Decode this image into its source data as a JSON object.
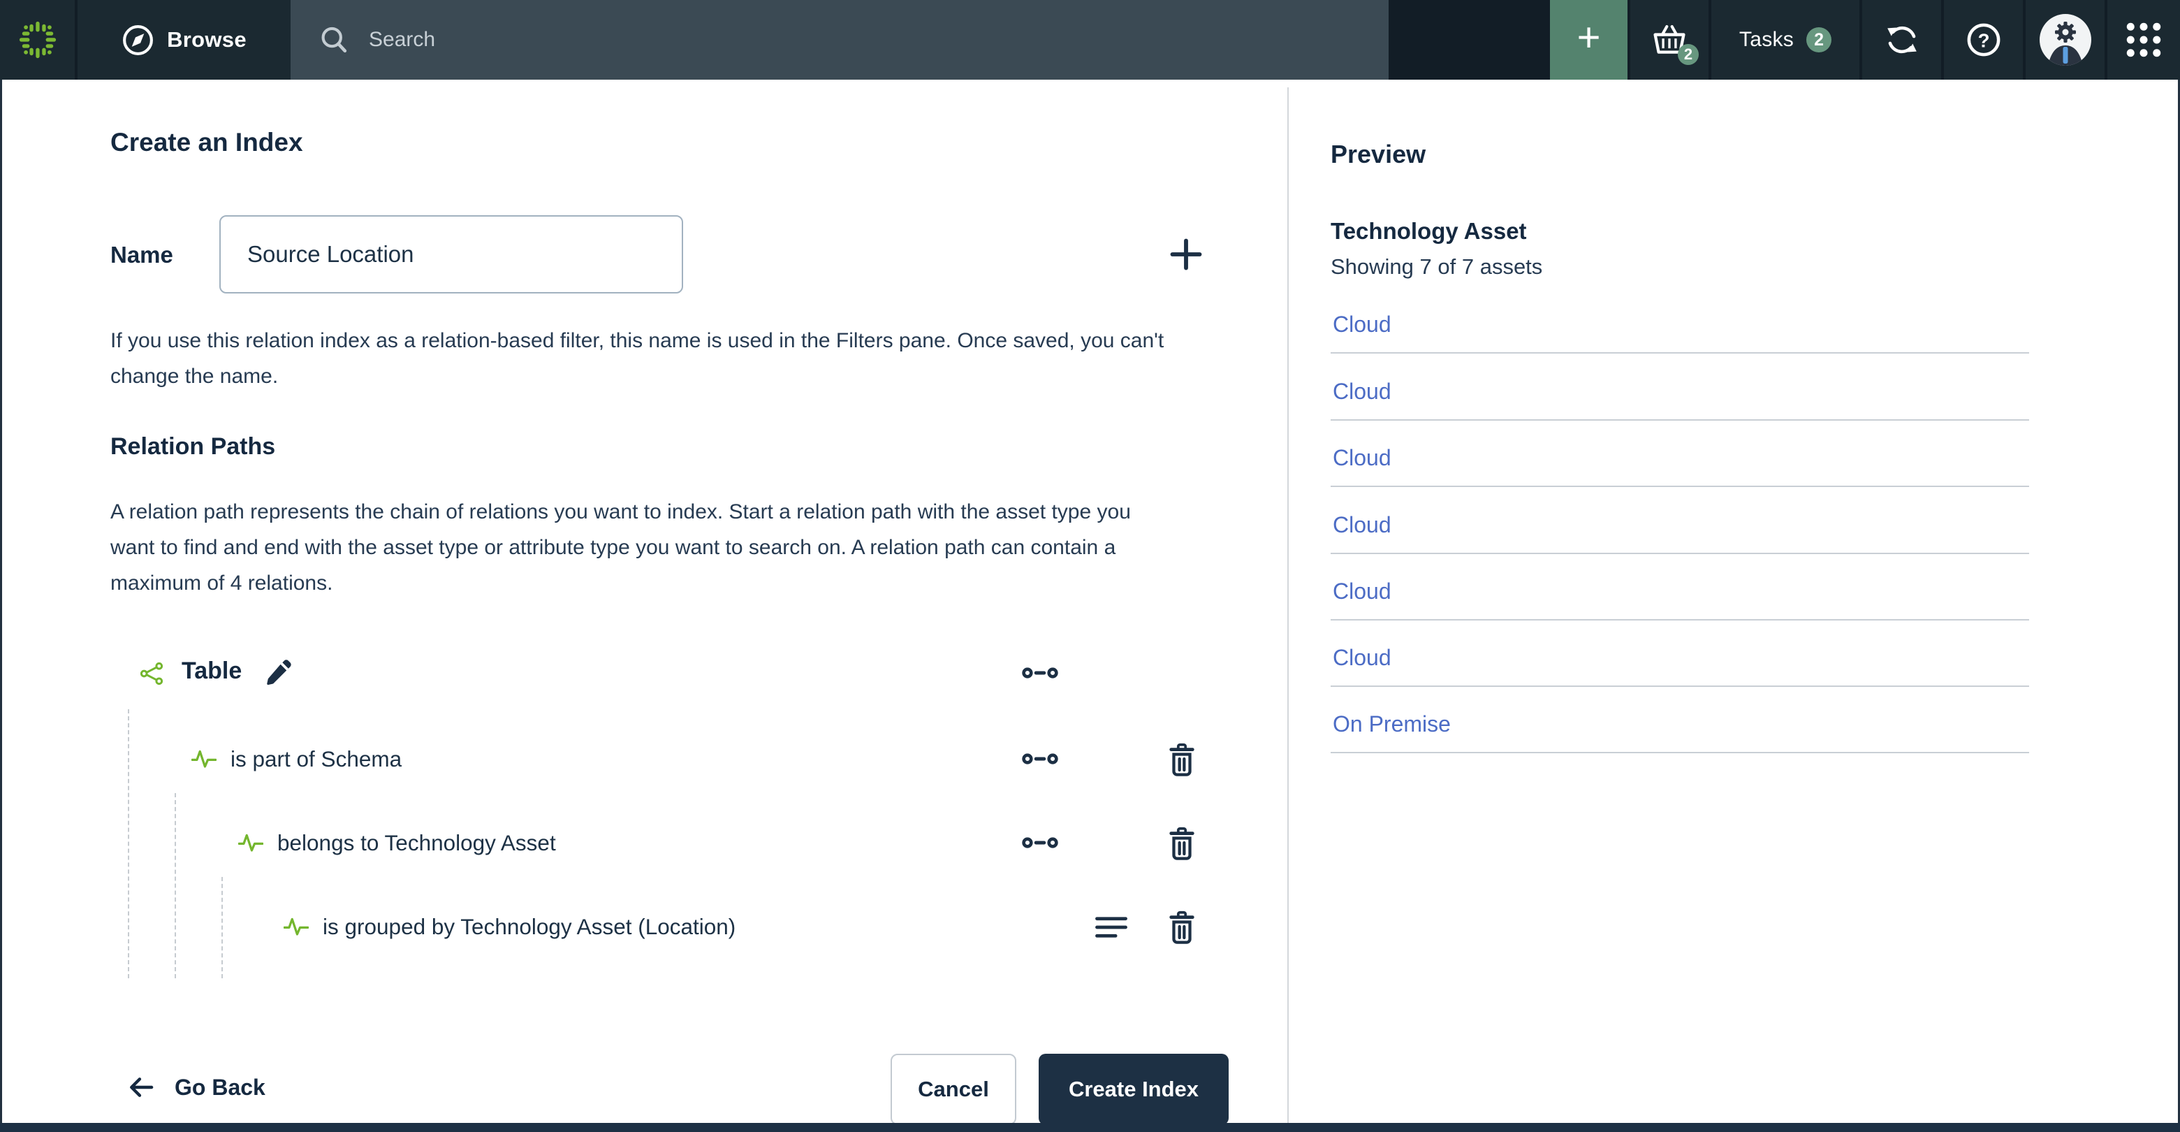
{
  "topbar": {
    "browse_label": "Browse",
    "search_placeholder": "Search",
    "plus_label": "+",
    "cart_count": "2",
    "tasks_label": "Tasks",
    "tasks_count": "2"
  },
  "page": {
    "title": "Create an Index",
    "name_label": "Name",
    "name_value": "Source Location",
    "name_help": "If you use this relation index as a relation-based filter, this name is used in the Filters pane. Once saved, you can't change the name.",
    "relation_paths": {
      "heading": "Relation Paths",
      "description": "A relation path represents the chain of relations you want to index. Start a relation path with the asset type you want to find and end with the asset type or attribute type you want to search on. A relation path can contain a maximum of 4 relations.",
      "root_label": "Table",
      "relations": [
        {
          "label": "is part of Schema"
        },
        {
          "label": "belongs to Technology Asset"
        },
        {
          "label": "is grouped by Technology Asset (Location)"
        }
      ]
    },
    "go_back_label": "Go Back",
    "cancel_label": "Cancel",
    "create_label": "Create Index"
  },
  "preview": {
    "heading": "Preview",
    "asset_type": "Technology Asset",
    "showing": "Showing 7 of 7 assets",
    "items": [
      "Cloud",
      "Cloud",
      "Cloud",
      "Cloud",
      "Cloud",
      "Cloud",
      "On Premise"
    ]
  },
  "icons": {
    "logo": "collibra-green-dashes",
    "browse": "compass",
    "search": "magnifier",
    "cart": "shopping-basket",
    "sync": "circular-arrows",
    "help": "question-circle",
    "avatar": "gear-head-person",
    "apps": "grid-3x3-dots",
    "root_type": "relation-nodes",
    "relation": "pulse-wave",
    "cardinality": "circle-dash-circle",
    "attribute": "text-lines",
    "delete": "trash-can",
    "edit": "pencil"
  },
  "colors": {
    "topbar_bg": "#121d26",
    "topbar_segment_bg": "#1b2931",
    "search_bg": "#3b4a54",
    "accent_green_button": "#54836e",
    "badge_green": "#67977f",
    "brand_green": "#74b62e",
    "navy_text": "#152940",
    "body_text": "#273b52",
    "link_blue": "#4c6cc5",
    "primary_button_bg": "#1d3044",
    "divider_gray": "#c9cfd5"
  }
}
